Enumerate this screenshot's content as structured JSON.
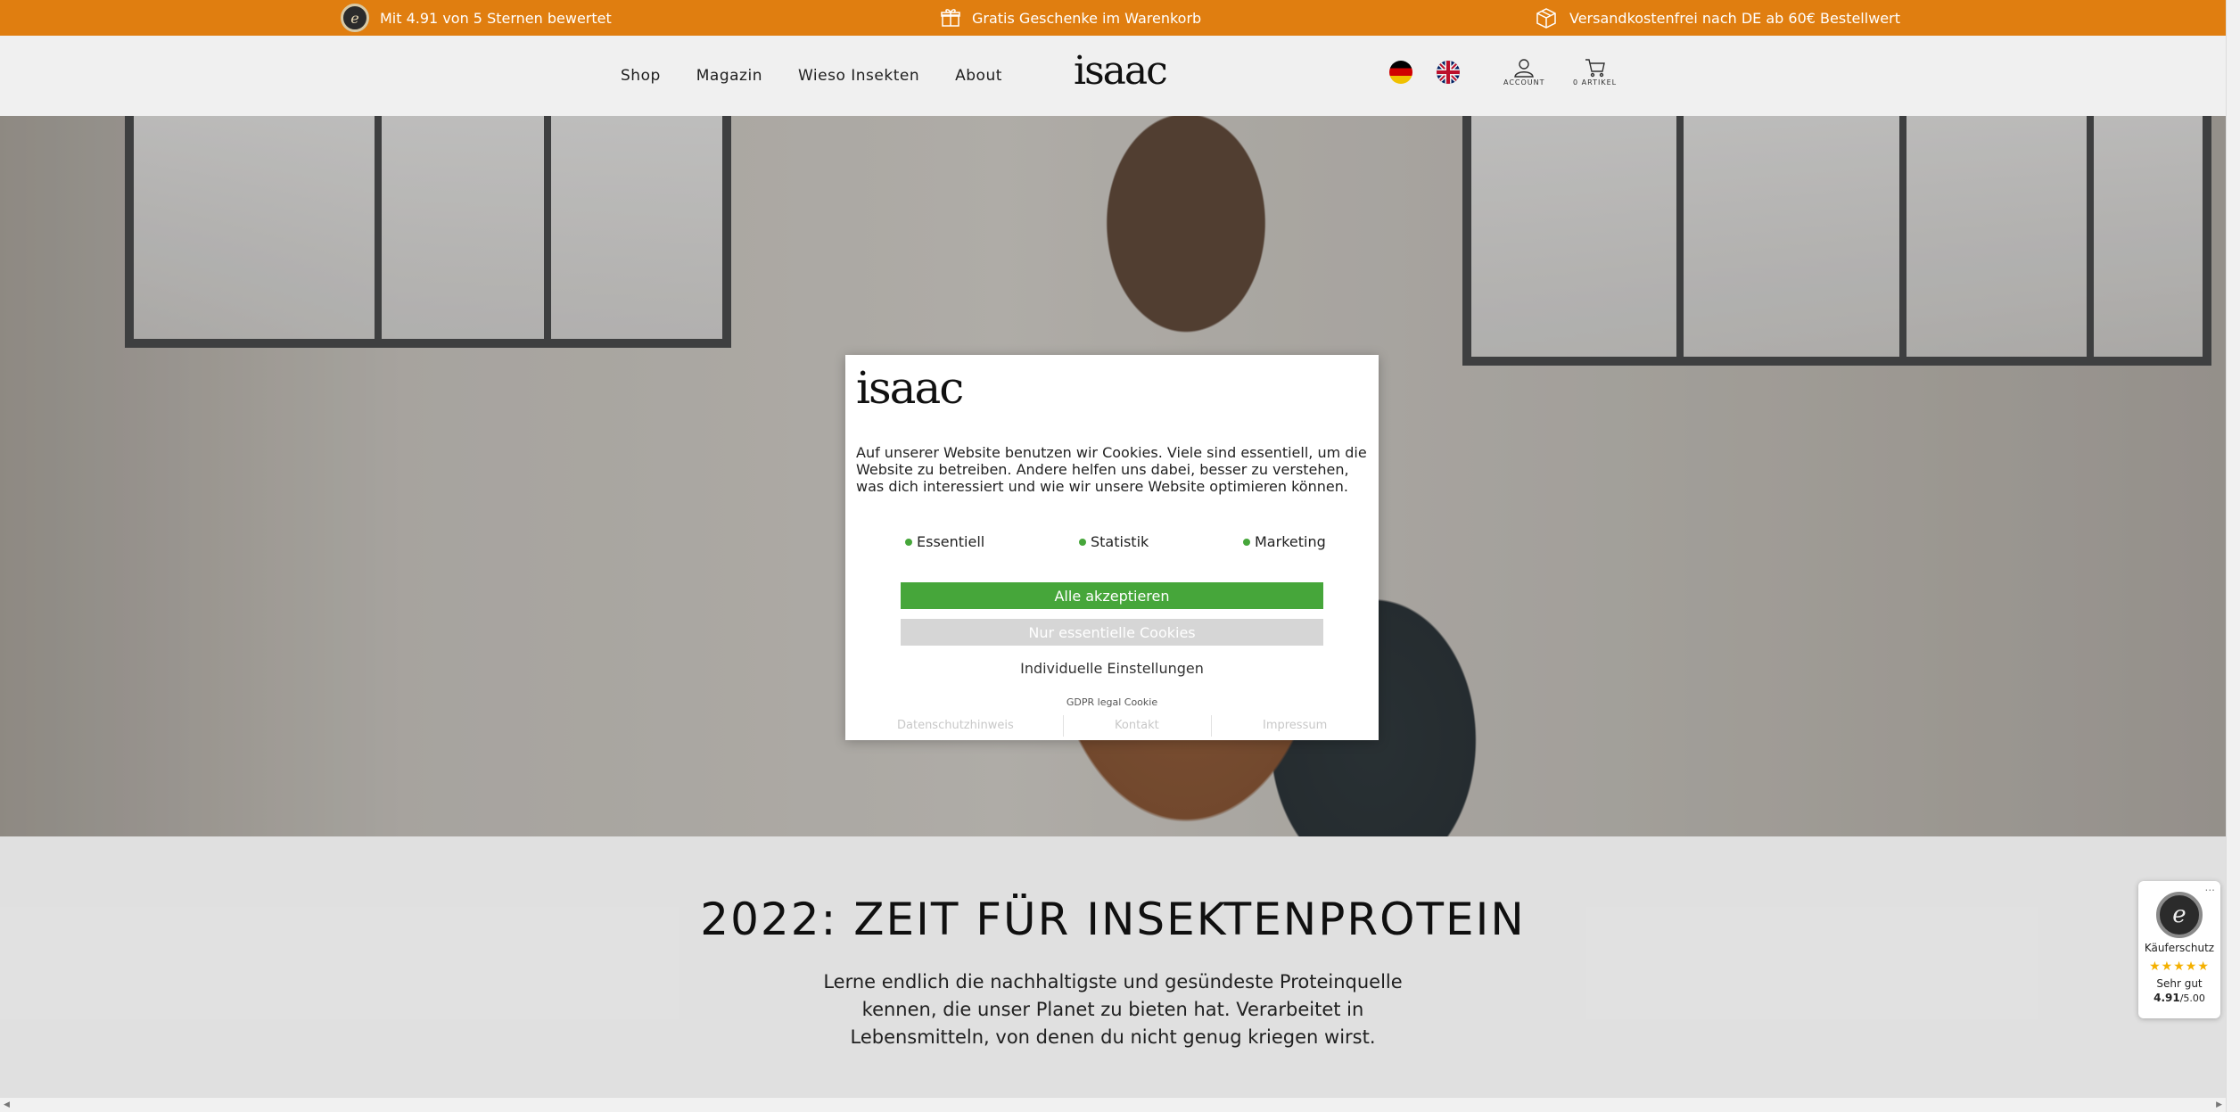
{
  "topbar": {
    "rating_text": "Mit 4.91 von 5 Sternen bewertet",
    "gift_text": "Gratis Geschenke im Warenkorb",
    "shipping_text": "Versandkostenfrei nach DE ab 60€ Bestellwert"
  },
  "header": {
    "nav": [
      "Shop",
      "Magazin",
      "Wieso Insekten",
      "About"
    ],
    "logo": "isaac",
    "account_label": "ACCOUNT",
    "cart_label": "0 ARTIKEL"
  },
  "intro": {
    "heading": "2022: ZEIT FÜR INSEKTENPROTEIN",
    "text": "Lerne endlich die nachhaltigste und gesündeste Proteinquelle kennen, die unser Planet zu bieten hat. Verarbeitet in Lebensmitteln, von denen du nicht genug kriegen wirst."
  },
  "cookie_modal": {
    "logo": "isaac",
    "text": "Auf unserer Website benutzen wir Cookies. Viele sind essentiell, um die Website zu betreiben. Andere helfen uns dabei, besser zu verstehen, was dich interessiert und wie wir unsere Website optimieren können.",
    "options": [
      "Essentiell",
      "Statistik",
      "Marketing"
    ],
    "accept_all": "Alle akzeptieren",
    "essential_only": "Nur essentielle Cookies",
    "individual": "Individuelle Einstellungen",
    "gdpr": "GDPR legal Cookie",
    "links": [
      "Datenschutzhinweis",
      "Kontakt",
      "Impressum"
    ]
  },
  "trust_badge": {
    "label": "Käuferschutz",
    "stars": "★★★★★",
    "grade": "Sehr gut",
    "score": "4.91",
    "max": "/5.00",
    "more": "..."
  },
  "colors": {
    "topbar": "#e07e10",
    "accept": "#46a63a",
    "essential": "#d6d6d6"
  }
}
